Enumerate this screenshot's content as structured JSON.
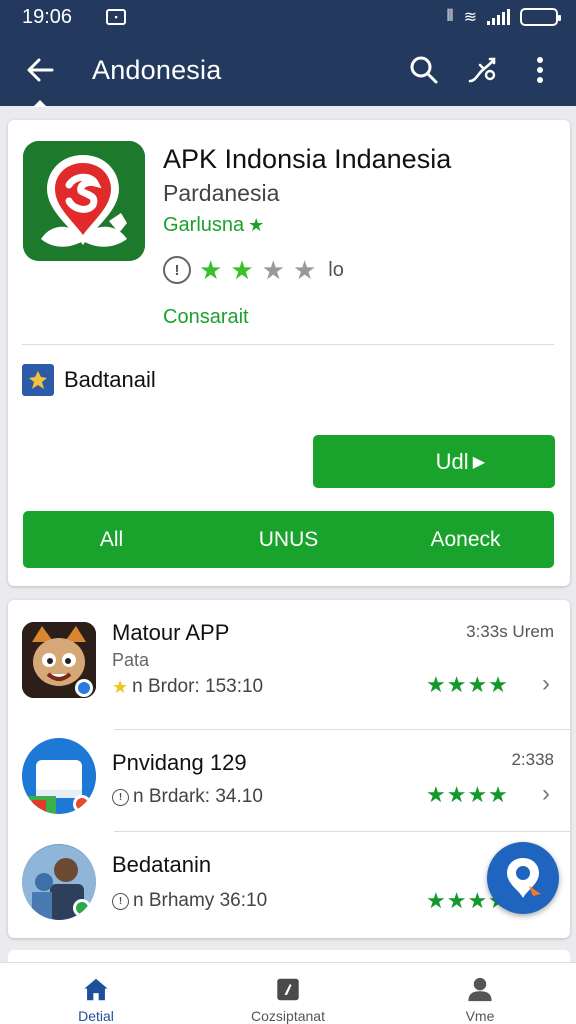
{
  "status_bar": {
    "time": "19:06"
  },
  "app_bar": {
    "title": "Andonesia"
  },
  "app": {
    "name": "APK Indonsia Indanesia",
    "developer": "Pardanesia",
    "category": "Garlusna",
    "rating": 2,
    "rating_max": 5,
    "rating_count": "lo",
    "status": "Consarait",
    "badge_label": "Badtanail",
    "install_label": "Udl"
  },
  "actions": [
    "All",
    "UNUS",
    "Aoneck"
  ],
  "list": [
    {
      "title": "Matour APP",
      "subtitle": "Pata",
      "meta": "n Brdor: 153:10",
      "time": "3:33s Urem",
      "stars": 4
    },
    {
      "title": "Pnvidang 129",
      "subtitle": "",
      "meta": "n Brdark: 34.10",
      "time": "2:338",
      "stars": 4
    },
    {
      "title": "Bedatanin",
      "subtitle": "",
      "meta": "n Brhamy 36:10",
      "time": "",
      "stars": 4
    }
  ],
  "bottom_nav": [
    {
      "label": "Detial",
      "icon": "home-icon",
      "active": true
    },
    {
      "label": "Cozsiptanat",
      "icon": "bookmark-icon",
      "active": false
    },
    {
      "label": "Vme",
      "icon": "person-icon",
      "active": false
    }
  ],
  "colors": {
    "primary": "#233a5e",
    "accent_green": "#19a32d",
    "star_green": "#3ac02a",
    "nav_active": "#1f4f9a"
  }
}
